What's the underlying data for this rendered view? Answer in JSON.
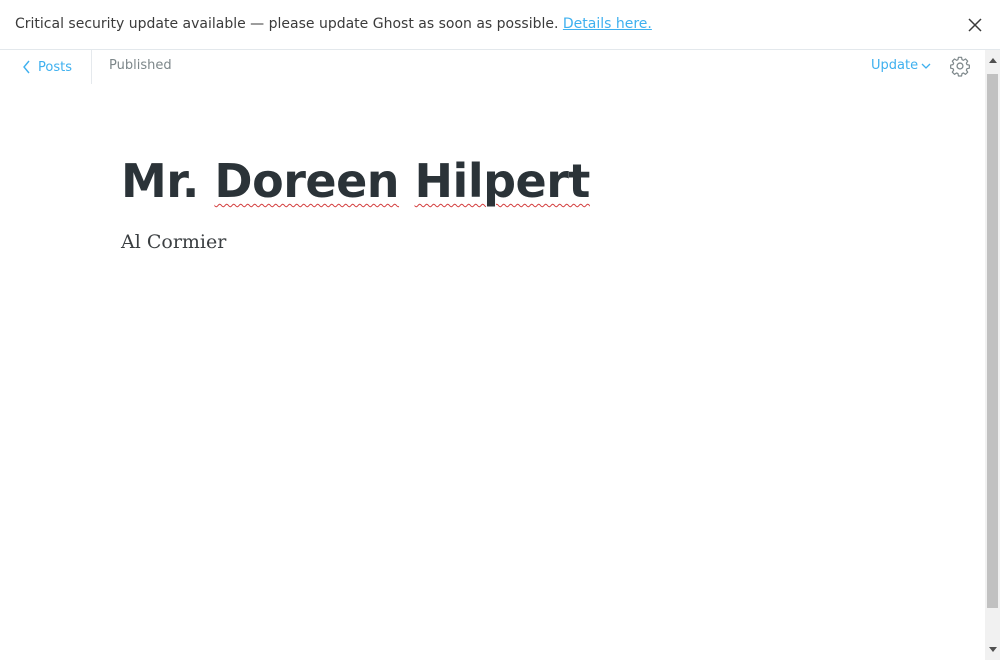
{
  "banner": {
    "message": "Critical security update available — please update Ghost as soon as possible.",
    "link_text": "Details here."
  },
  "header": {
    "back_label": "Posts",
    "status": "Published",
    "update_label": "Update"
  },
  "post": {
    "title_words": [
      "Mr.",
      "Doreen",
      "Hilpert"
    ],
    "body": "Al Cormier"
  },
  "colors": {
    "accent": "#3eb0ef",
    "title": "#2b3338",
    "muted": "#7d878a",
    "spellcheck": "#d33c3c"
  },
  "icons": {
    "back": "chevron-left-icon",
    "close": "close-icon",
    "dropdown": "chevron-down-icon",
    "settings": "gear-icon"
  }
}
